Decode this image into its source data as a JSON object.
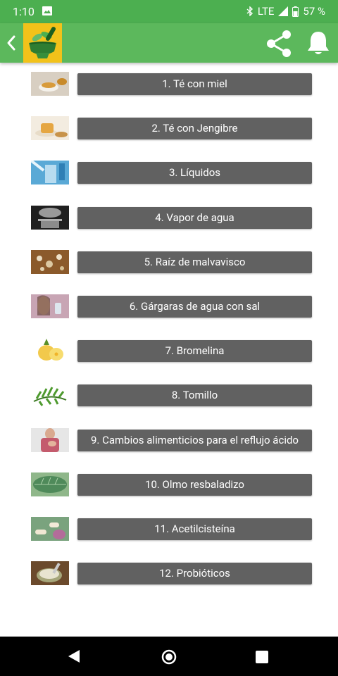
{
  "status_bar": {
    "time": "1:10",
    "network": "LTE",
    "battery": "57 %"
  },
  "app_bar": {
    "back_icon": "chevron-left-icon",
    "logo_icon": "mortar-pestle-leaves-logo",
    "share_icon": "share-icon",
    "notifications_icon": "bell-icon"
  },
  "remedies": [
    {
      "label": "1. Té con miel",
      "image": "honey-tea-photo"
    },
    {
      "label": "2. Té con Jengibre",
      "image": "ginger-tea-photo"
    },
    {
      "label": "3. Líquidos",
      "image": "water-glass-photo"
    },
    {
      "label": "4. Vapor de agua",
      "image": "steaming-pot-photo"
    },
    {
      "label": "5. Raíz de malvavisco",
      "image": "marshmallow-root-photo"
    },
    {
      "label": "6. Gárgaras de agua con sal",
      "image": "woman-gargling-photo"
    },
    {
      "label": "7. Bromelina",
      "image": "pineapple-photo"
    },
    {
      "label": "8. Tomillo",
      "image": "thyme-sprig-photo"
    },
    {
      "label": "9. Cambios alimenticios para el reflujo ácido",
      "image": "woman-heartburn-photo"
    },
    {
      "label": "10. Olmo resbaladizo",
      "image": "elm-leaf-photo"
    },
    {
      "label": "11. Acetilcisteína",
      "image": "capsules-photo"
    },
    {
      "label": "12. Probióticos",
      "image": "yogurt-bowl-photo"
    }
  ],
  "colors": {
    "status_bar": "#4caf50",
    "app_bar": "#5cb85c",
    "button": "#616161",
    "logo_bg": "#f2c21a"
  }
}
